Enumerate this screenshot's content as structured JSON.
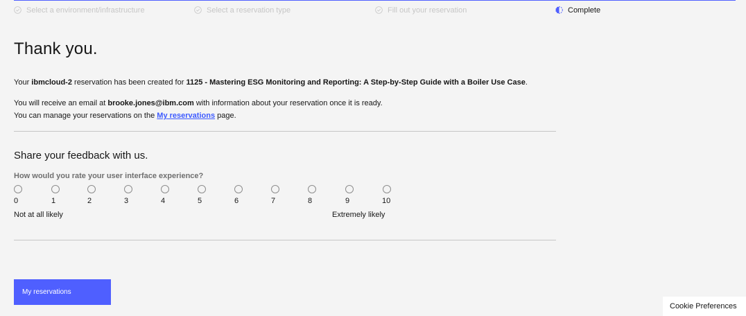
{
  "progress": {
    "steps": [
      {
        "label": "Select a environment/infrastructure",
        "state": "complete"
      },
      {
        "label": "Select a reservation type",
        "state": "complete"
      },
      {
        "label": "Fill out your reservation",
        "state": "complete"
      },
      {
        "label": "Complete",
        "state": "current"
      }
    ],
    "accent": "#4f5fff"
  },
  "confirmation": {
    "title": "Thank you.",
    "line1_prefix": "Your ",
    "environment": "ibmcloud-2",
    "line1_middle": " reservation has been created for ",
    "course": "1125 - Mastering ESG Monitoring and Reporting: A Step-by-Step Guide with a Boiler Use Case",
    "line1_suffix": ".",
    "line2_prefix": "You will receive an email at ",
    "email": "brooke.jones@ibm.com",
    "line2_suffix": " with information about your reservation once it is ready.",
    "line3_prefix": "You can manage your reservations on the ",
    "line3_link": "My reservations",
    "line3_suffix": " page."
  },
  "feedback": {
    "heading": "Share your feedback with us.",
    "question": "How would you rate your user interface experience?",
    "options": [
      "0",
      "1",
      "2",
      "3",
      "4",
      "5",
      "6",
      "7",
      "8",
      "9",
      "10"
    ],
    "low_label": "Not at all likely",
    "high_label": "Extremely likely"
  },
  "actions": {
    "my_reservations_button": "My reservations"
  },
  "cookie": {
    "label": "Cookie Preferences"
  }
}
